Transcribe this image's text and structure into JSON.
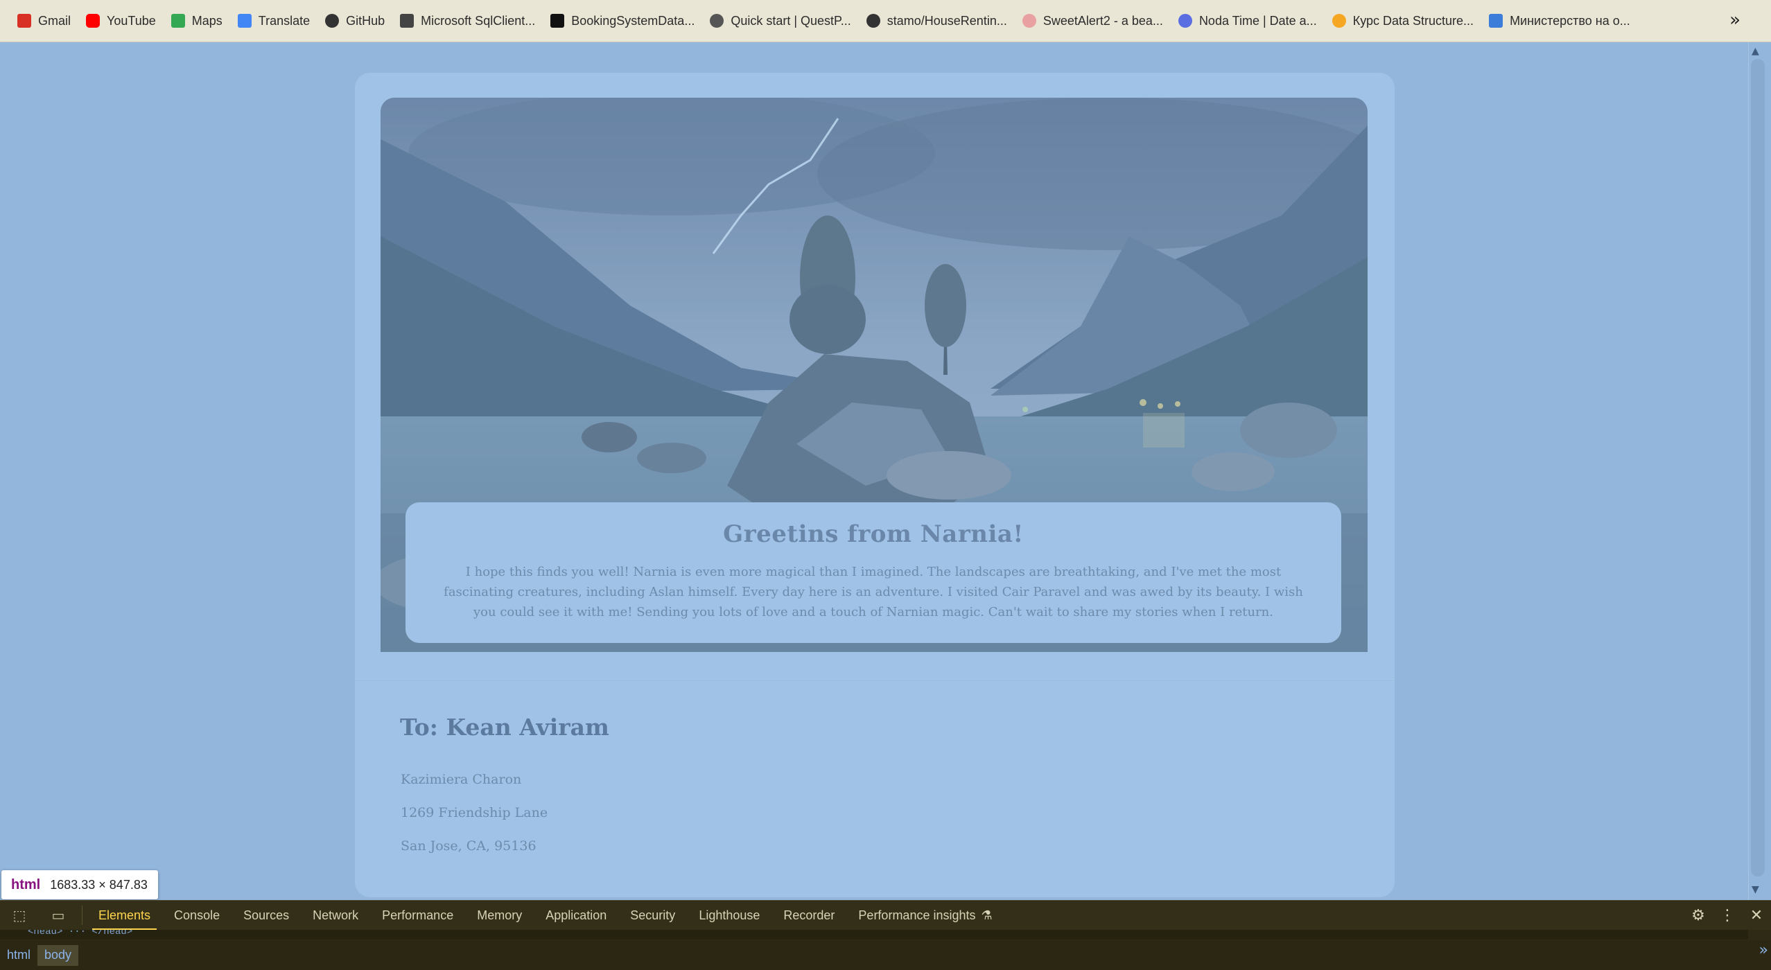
{
  "bookmarks": [
    {
      "label": "Gmail",
      "icon": "gmail-icon",
      "color": "#d93025"
    },
    {
      "label": "YouTube",
      "icon": "youtube-icon",
      "color": "#ff0000"
    },
    {
      "label": "Maps",
      "icon": "maps-icon",
      "color": "#34a853"
    },
    {
      "label": "Translate",
      "icon": "translate-icon",
      "color": "#4285f4"
    },
    {
      "label": "GitHub",
      "icon": "github-icon",
      "color": "#333333"
    },
    {
      "label": "Microsoft SqlClient...",
      "icon": "sqlclient-icon",
      "color": "#444444"
    },
    {
      "label": "BookingSystemData...",
      "icon": "booking-icon",
      "color": "#111111"
    },
    {
      "label": "Quick start | QuestP...",
      "icon": "questpdf-icon",
      "color": "#555555"
    },
    {
      "label": "stamo/HouseRentin...",
      "icon": "github-icon",
      "color": "#333333"
    },
    {
      "label": "SweetAlert2 - a bea...",
      "icon": "sweetalert-icon",
      "color": "#e8a0a0"
    },
    {
      "label": "Noda Time | Date a...",
      "icon": "nodatime-icon",
      "color": "#5b6ee1"
    },
    {
      "label": "Курс Data Structure...",
      "icon": "course-icon",
      "color": "#f5a623"
    },
    {
      "label": "Министерство на о...",
      "icon": "book-icon",
      "color": "#3b7dd8"
    }
  ],
  "bookmarks_more": "»",
  "postcard": {
    "title": "Greetins from Narnia!",
    "message": "I hope this finds you well! Narnia is even more magical than I imagined. The landscapes are breathtaking, and I've met the most fascinating creatures, including Aslan himself. Every day here is an adventure. I visited Cair Paravel and was awed by its beauty. I wish you could see it with me! Sending you lots of love and a touch of Narnian magic. Can't wait to share my stories when I return.",
    "to": "To: Kean Aviram",
    "sender_name": "Kazimiera Charon",
    "street": "1269 Friendship Lane",
    "city": "San Jose, CA, 95136"
  },
  "inspect_tooltip": {
    "tag": "html",
    "dimensions": "1683.33 × 847.83"
  },
  "devtools": {
    "tabs": [
      "Elements",
      "Console",
      "Sources",
      "Network",
      "Performance",
      "Memory",
      "Application",
      "Security",
      "Lighthouse",
      "Recorder",
      "Performance insights"
    ],
    "active_tab": "Elements",
    "partial_line": "<head> ··· </head>",
    "breadcrumbs": [
      "html",
      "body"
    ]
  },
  "colors": {
    "page_bg": "#93b6dc",
    "card_bg": "#9fc2e6",
    "devtools_bg": "#332f18",
    "accent": "#ffd54f"
  }
}
